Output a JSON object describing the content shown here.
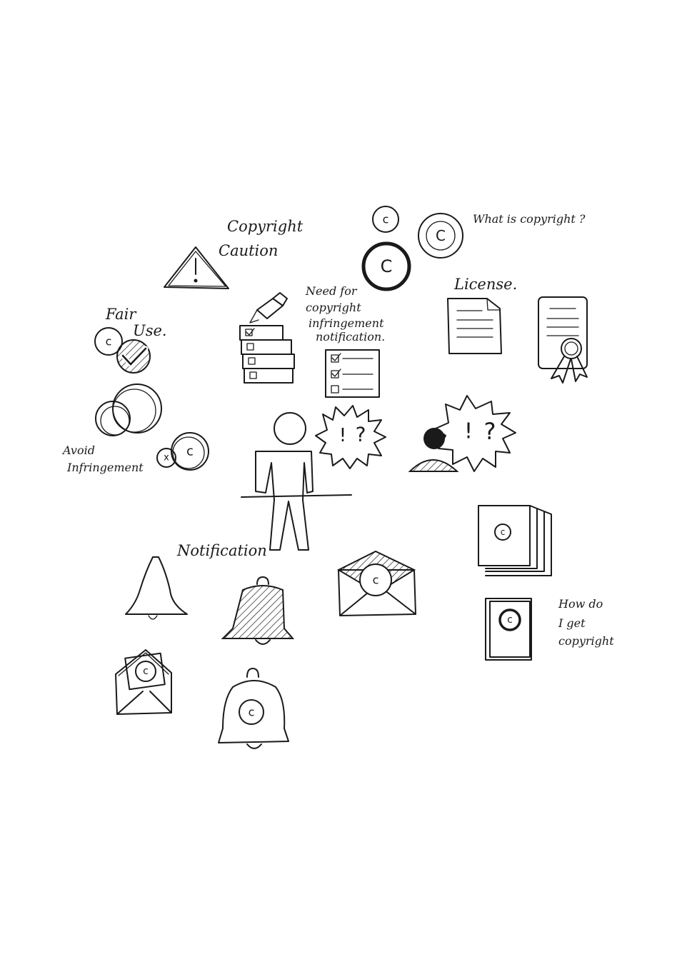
{
  "labels": {
    "copyright_caution_1": "Copyright",
    "copyright_caution_2": "Caution",
    "what_is_copyright": "What is copyright ?",
    "license": "License.",
    "need_for_1": "Need for",
    "need_for_2": "copyright",
    "need_for_3": "infringement",
    "need_for_4": "notification.",
    "fair_use_1": "Fair",
    "fair_use_2": "Use.",
    "avoid_1": "Avoid",
    "avoid_2": "Infringement",
    "notification": "Notification",
    "how_do_1": "How do",
    "how_do_2": "I get",
    "how_do_3": "copyright"
  },
  "glyphs": {
    "c": "c",
    "C": "C",
    "x": "x",
    "excl": "!",
    "quest": "?"
  },
  "ink_color": "#1a1a1a",
  "paper_color": "#ffffff"
}
